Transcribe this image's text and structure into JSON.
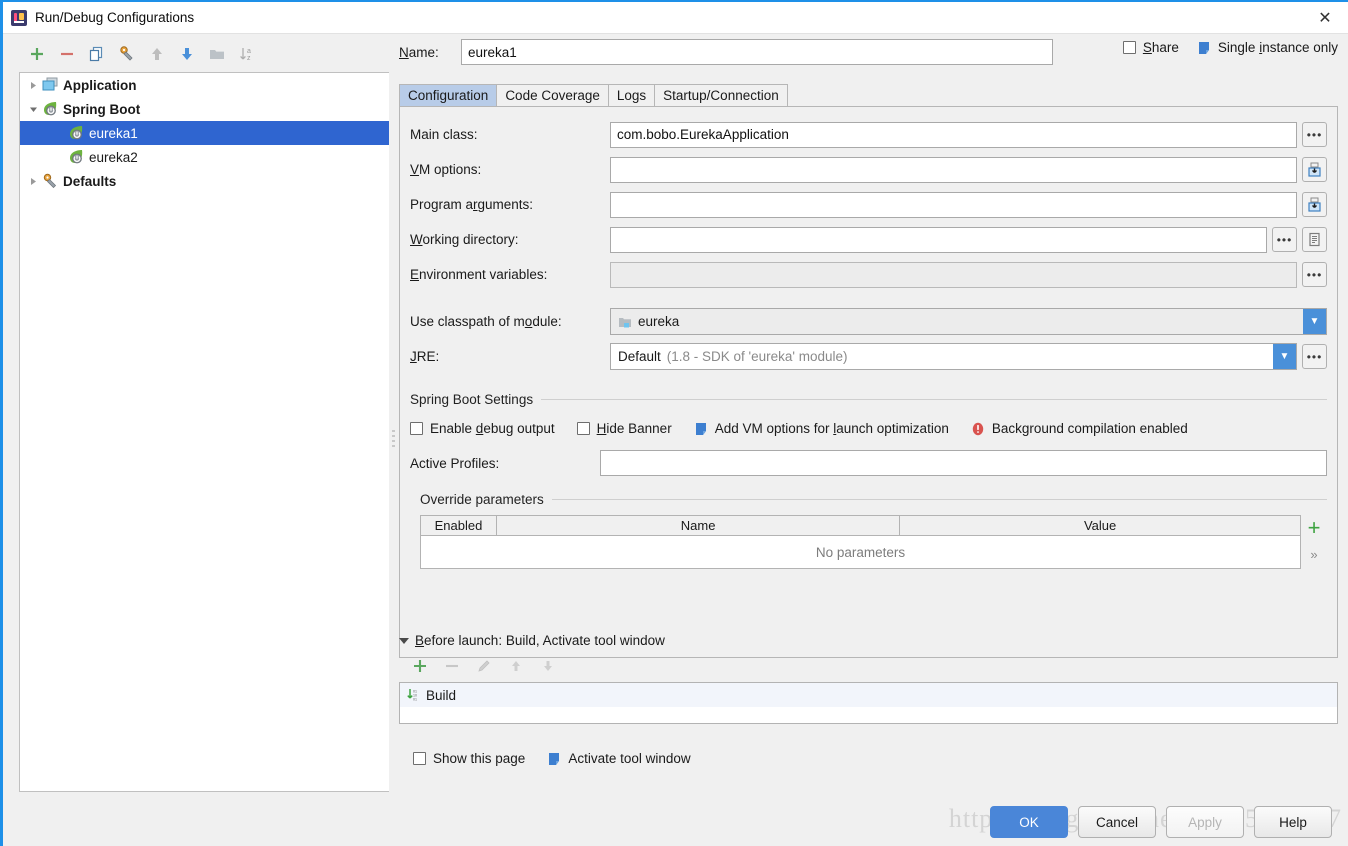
{
  "window": {
    "title": "Run/Debug Configurations",
    "close_icon": "close-icon",
    "app_icon": "intellij-idea-icon"
  },
  "tree_toolbar": {
    "buttons": [
      {
        "name": "add-configuration-button",
        "icon": "plus-icon"
      },
      {
        "name": "remove-configuration-button",
        "icon": "minus-icon"
      },
      {
        "name": "copy-configuration-button",
        "icon": "copy-icon"
      },
      {
        "name": "edit-templates-button",
        "icon": "wrench-icon"
      },
      {
        "name": "move-up-button",
        "icon": "arrow-up-icon"
      },
      {
        "name": "move-down-button",
        "icon": "arrow-down-icon"
      },
      {
        "name": "create-folder-button",
        "icon": "folder-icon"
      },
      {
        "name": "sort-configurations-button",
        "icon": "sort-az-icon"
      }
    ]
  },
  "tree": {
    "items": [
      {
        "label": "Application",
        "icon": "application-icon",
        "twisty": "collapsed",
        "level": 0,
        "selected": false
      },
      {
        "label": "Spring Boot",
        "icon": "spring-boot-icon",
        "twisty": "expanded",
        "level": 0,
        "selected": false
      },
      {
        "label": "eureka1",
        "icon": "spring-boot-icon",
        "twisty": "none",
        "level": 1,
        "selected": true
      },
      {
        "label": "eureka2",
        "icon": "spring-boot-icon",
        "twisty": "none",
        "level": 1,
        "selected": false
      },
      {
        "label": "Defaults",
        "icon": "wrench-icon",
        "twisty": "collapsed",
        "level": 0,
        "selected": false
      }
    ]
  },
  "header": {
    "name_label": "Name:",
    "name_value": "eureka1",
    "name_placeholder": "",
    "share_label": "Share",
    "share_checked": false,
    "single_instance_label": "Single instance only",
    "single_instance_icon": "tool-window-icon"
  },
  "tabs": [
    {
      "label": "Configuration",
      "active": true
    },
    {
      "label": "Code Coverage",
      "active": false
    },
    {
      "label": "Logs",
      "active": false
    },
    {
      "label": "Startup/Connection",
      "active": false
    }
  ],
  "configuration": {
    "fields": [
      {
        "label": "Main class:",
        "value": "com.bobo.EurekaApplication",
        "placeholder": "",
        "disabled": false,
        "buttons": [
          "browse-dots-icon"
        ]
      },
      {
        "label": "VM options:",
        "value": "",
        "placeholder": "",
        "disabled": false,
        "buttons": [
          "expand-editor-icon"
        ]
      },
      {
        "label": "Program arguments:",
        "value": "",
        "placeholder": "",
        "disabled": false,
        "buttons": [
          "expand-editor-icon"
        ]
      },
      {
        "label": "Working directory:",
        "value": "",
        "placeholder": "",
        "disabled": false,
        "buttons": [
          "browse-dots-icon",
          "macro-list-icon"
        ]
      },
      {
        "label": "Environment variables:",
        "value": "",
        "placeholder": "",
        "disabled": true,
        "buttons": [
          "browse-dots-icon"
        ]
      }
    ],
    "classpath": {
      "label": "Use classpath of module:",
      "value": "eureka",
      "icon": "module-icon"
    },
    "jre": {
      "label": "JRE:",
      "value": "Default",
      "hint": "(1.8 - SDK of 'eureka' module)",
      "browse_icon": "browse-dots-icon"
    }
  },
  "spring_boot_settings": {
    "title": "Spring Boot Settings",
    "enable_debug_label": "Enable debug output",
    "enable_debug_checked": false,
    "hide_banner_label": "Hide Banner",
    "hide_banner_checked": false,
    "add_vm_options_label": "Add VM options for launch optimization",
    "add_vm_options_icon": "tool-window-icon",
    "background_compilation_label": "Background compilation enabled",
    "background_compilation_icon": "warning-icon",
    "active_profiles_label": "Active Profiles:",
    "active_profiles_value": "",
    "active_profiles_placeholder": ""
  },
  "override_parameters": {
    "title": "Override parameters",
    "columns": [
      "Enabled",
      "Name",
      "Value"
    ],
    "rows": [],
    "empty_text": "No parameters",
    "add_icon": "plus-icon",
    "expand_icon": "chevron-right-icon"
  },
  "before_launch": {
    "title": "Before launch: Build, Activate tool window",
    "toolbar": [
      {
        "name": "add-task-button",
        "icon": "plus-icon",
        "enabled": true
      },
      {
        "name": "remove-task-button",
        "icon": "minus-icon",
        "enabled": false
      },
      {
        "name": "edit-task-button",
        "icon": "pencil-icon",
        "enabled": false
      },
      {
        "name": "move-task-up-button",
        "icon": "arrow-up-icon",
        "enabled": false
      },
      {
        "name": "move-task-down-button",
        "icon": "arrow-down-icon",
        "enabled": false
      }
    ],
    "tasks": [
      {
        "label": "Build",
        "icon": "build-icon"
      }
    ],
    "show_page_label": "Show this page",
    "show_page_checked": false,
    "activate_tool_window_label": "Activate tool window",
    "activate_tool_window_icon": "tool-window-icon"
  },
  "footer": {
    "ok": "OK",
    "cancel": "Cancel",
    "apply": "Apply",
    "help": "Help"
  },
  "watermark": "https://blog.csdn.net/qq_25441147",
  "colors": {
    "selection_blue": "#2f65d0",
    "tab_active": "#b8cce8",
    "primary_button": "#4a86d8",
    "combo_arrow": "#4a90d9",
    "accent_green": "#3ea341",
    "warning_red": "#d9534f",
    "window_border": "#1e90e8"
  }
}
